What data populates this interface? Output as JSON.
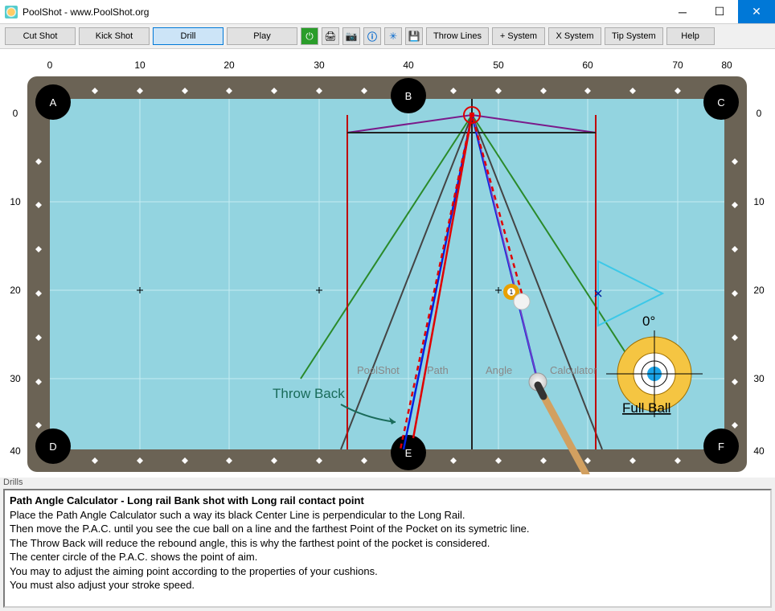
{
  "window": {
    "title": "PoolShot - www.PoolShot.org"
  },
  "toolbar": {
    "cut_shot": "Cut Shot",
    "kick_shot": "Kick Shot",
    "drill": "Drill",
    "play": "Play",
    "throw_lines": "Throw Lines",
    "plus_system": "+ System",
    "x_system": "X System",
    "tip_system": "Tip System",
    "help": "Help"
  },
  "table": {
    "ruler_x": [
      "0",
      "10",
      "20",
      "30",
      "40",
      "50",
      "60",
      "70",
      "80"
    ],
    "ruler_y": [
      "0",
      "10",
      "20",
      "30",
      "40"
    ],
    "pockets": {
      "tl": "A",
      "tm": "B",
      "tr": "C",
      "bl": "D",
      "bm": "E",
      "br": "F"
    },
    "watermark": [
      "PoolShot",
      "Path",
      "Angle",
      "Calculator"
    ],
    "throw_back_label": "Throw Back",
    "angle_label": "0°",
    "aim_label": "Full Ball"
  },
  "drills": {
    "section_label": "Drills",
    "heading": "Path Angle Calculator - Long rail Bank shot with Long rail contact point",
    "lines": [
      "Place the Path Angle Calculator such a way its black Center Line is perpendicular to the Long Rail.",
      "Then move the P.A.C. until you see the cue ball on a line and the farthest Point of the Pocket on its symetric line.",
      "The Throw Back will reduce the rebound angle, this is why the farthest point of the pocket is considered.",
      "The center circle of the P.A.C. shows the point of aim.",
      "You may to adjust the aiming point according to the properties of your cushions.",
      "You must also adjust your stroke speed."
    ]
  }
}
